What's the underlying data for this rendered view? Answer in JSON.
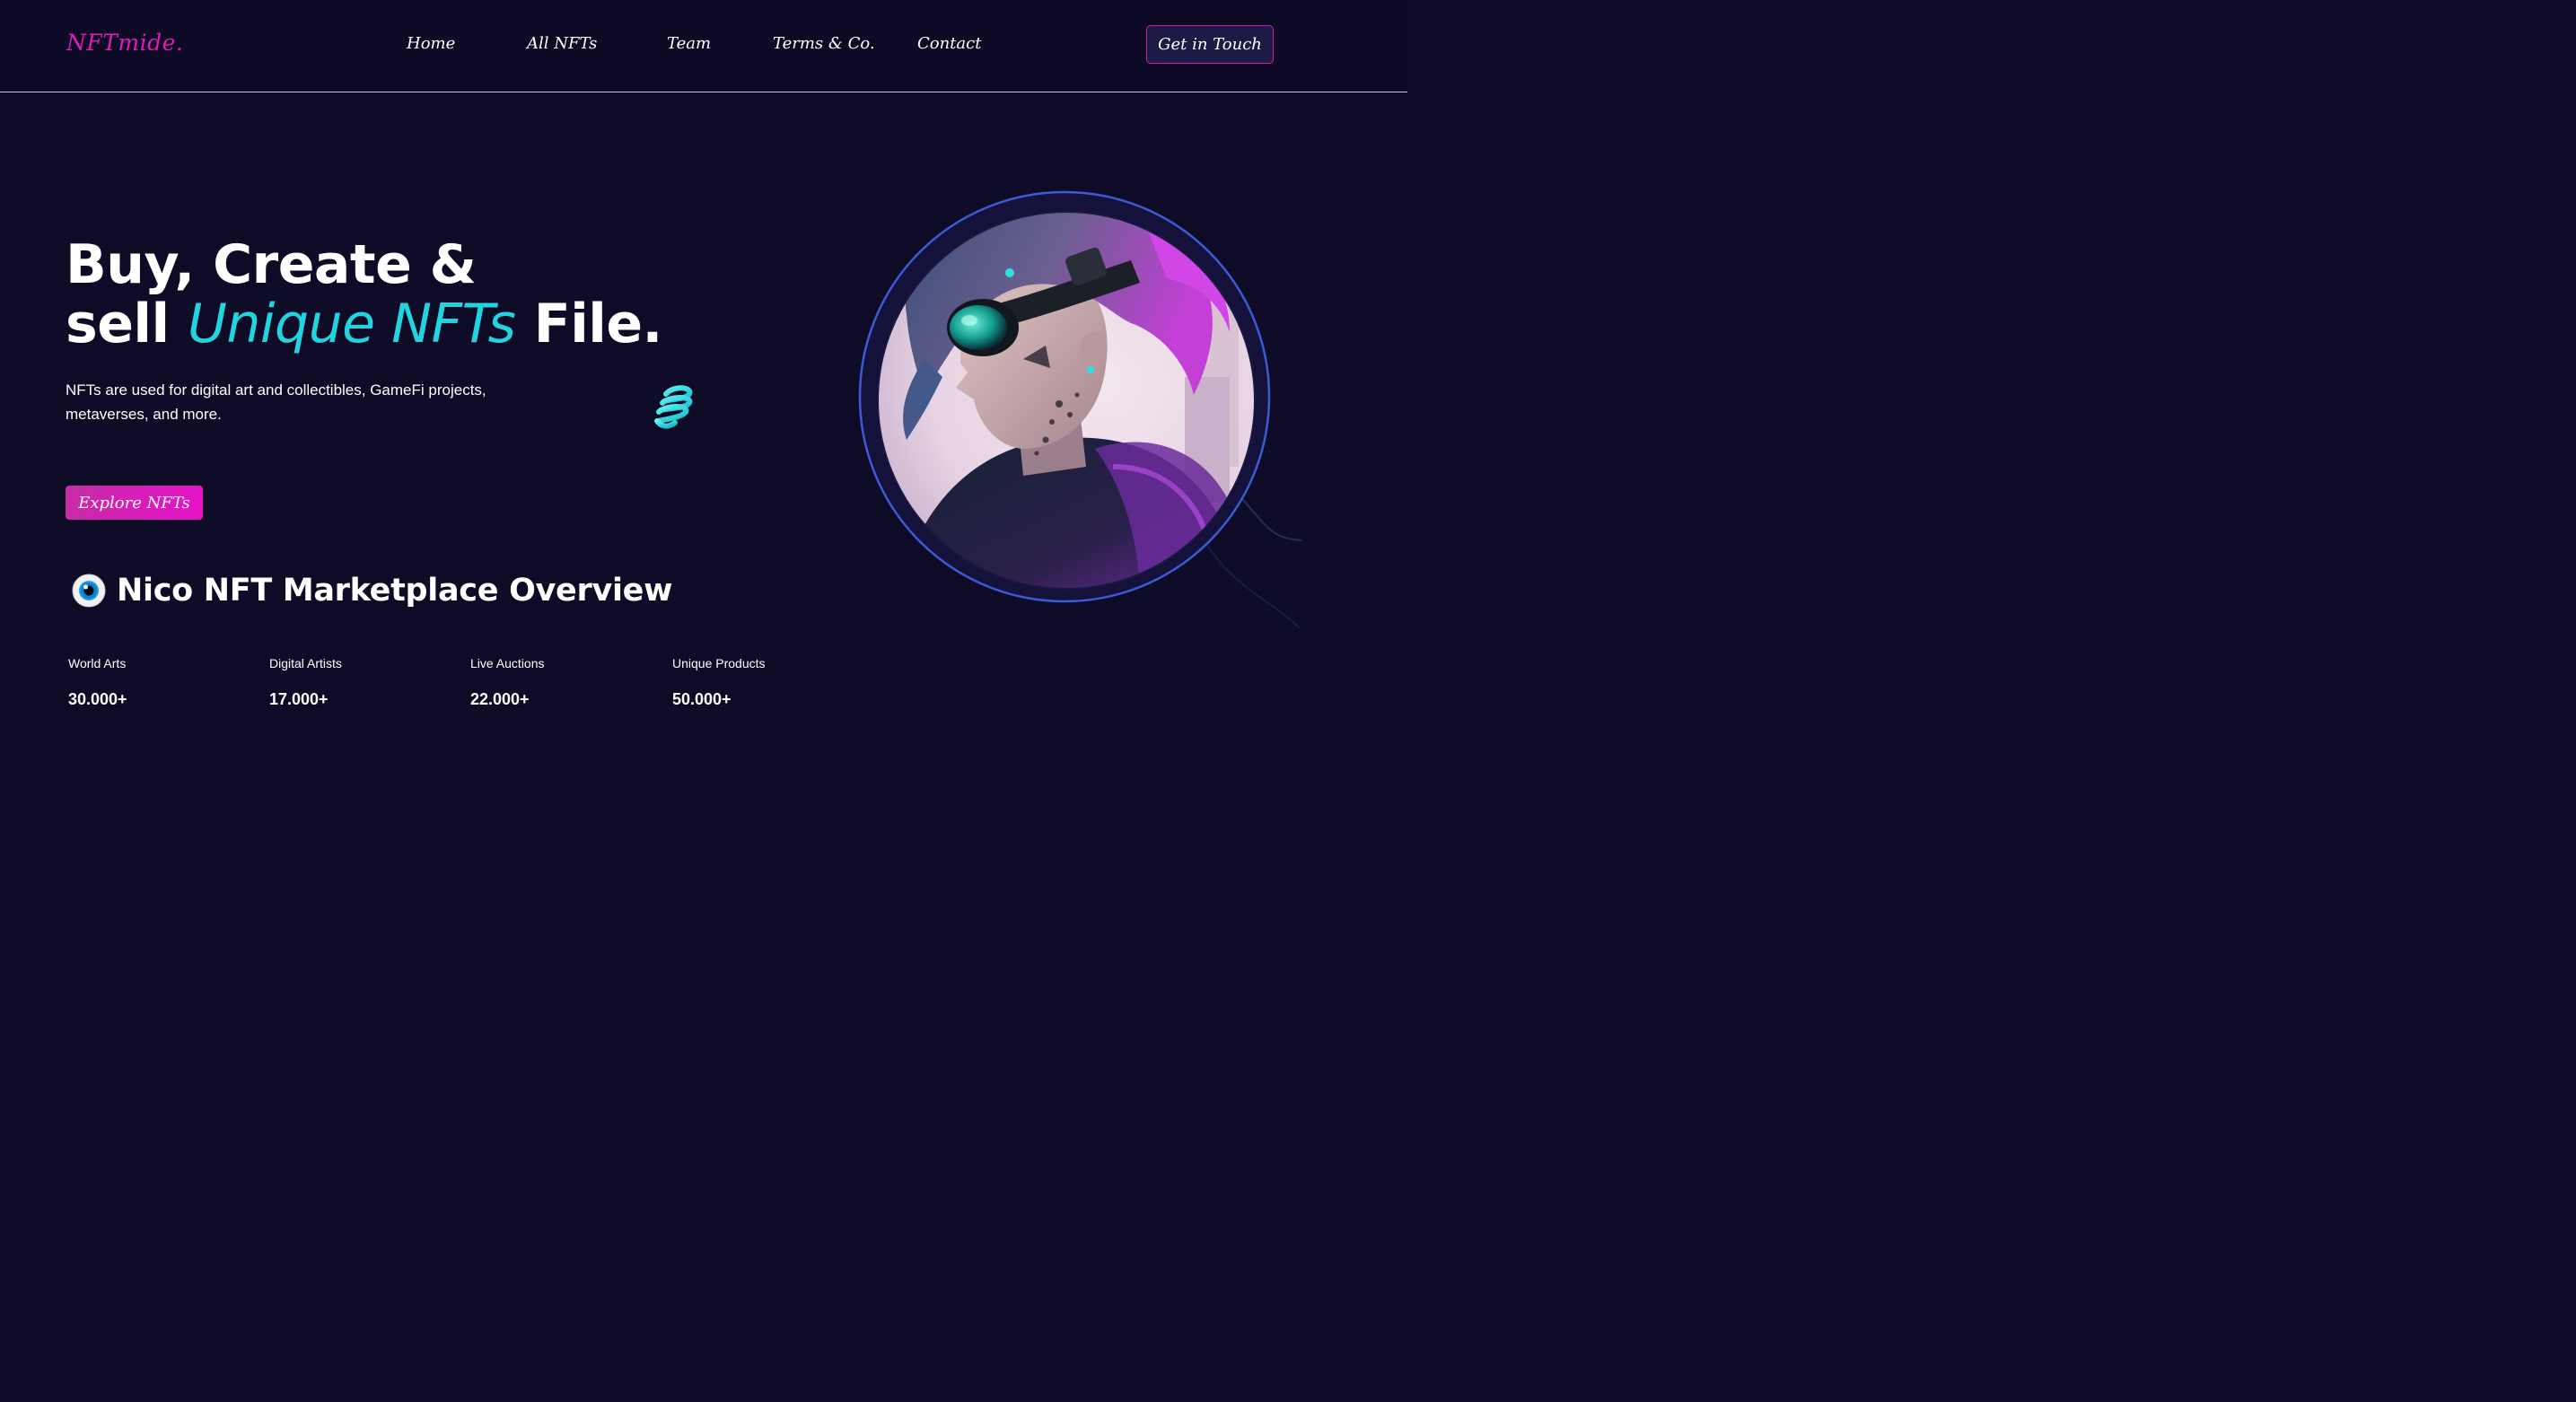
{
  "header": {
    "logo": "NFTmide.",
    "nav": {
      "home": "Home",
      "all_nfts": "All NFTs",
      "team": "Team",
      "terms": "Terms & Co.",
      "contact": "Contact"
    },
    "cta": "Get in Touch"
  },
  "hero": {
    "title_line1": "Buy, Create &",
    "title_sell": "sell",
    "title_accent": "Unique NFTs",
    "title_end": "File.",
    "description": "NFTs are used for digital art and collectibles, GameFi projects, metaverses, and more.",
    "explore_button": "Explore NFTs",
    "decor_icon": "spring-coil-icon",
    "image_icon": "cyberpunk-avatar-image"
  },
  "overview": {
    "icon": "eye-icon",
    "title": "Nico NFT Marketplace Overview",
    "stats": [
      {
        "label": "World Arts",
        "value": "30.000+"
      },
      {
        "label": "Digital Artists",
        "value": "17.000+"
      },
      {
        "label": "Live Auctions",
        "value": "22.000+"
      },
      {
        "label": "Unique Products",
        "value": "50.000+"
      }
    ]
  },
  "colors": {
    "background": "#0d0b26",
    "brand_pink": "#e01bb8",
    "accent_cyan": "#22d3e0",
    "ring_blue": "#3b5bd6"
  }
}
